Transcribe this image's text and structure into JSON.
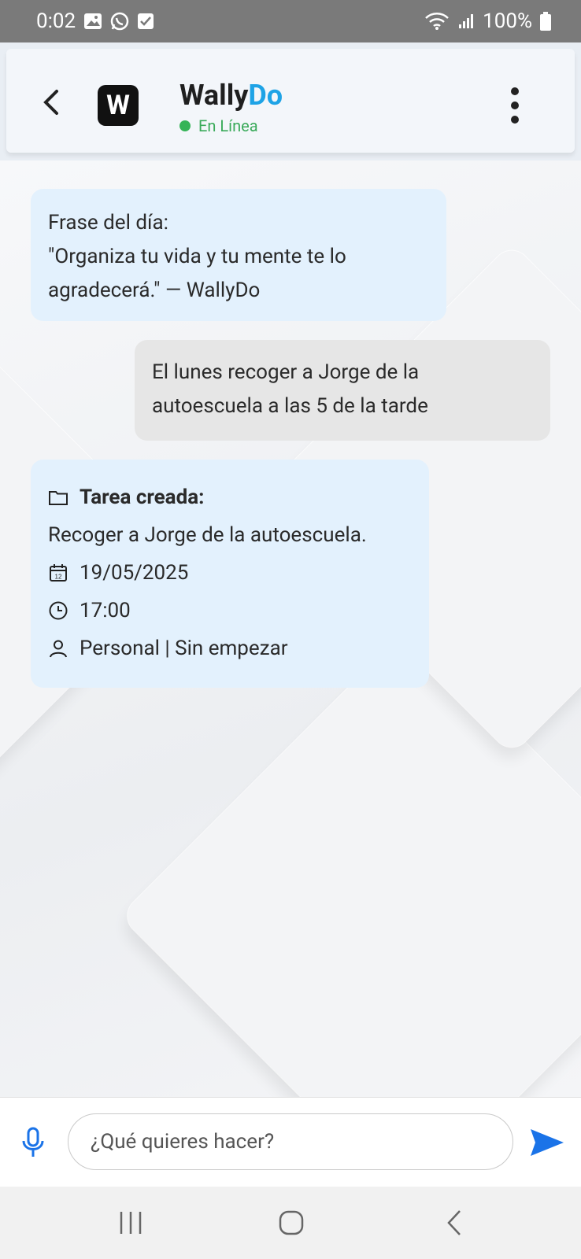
{
  "status_bar": {
    "time": "0:02",
    "battery": "100%"
  },
  "header": {
    "app_name_part1": "Wally",
    "app_name_part2": "Do",
    "logo_letter": "W",
    "status": "En Línea"
  },
  "messages": {
    "quote_title": "Frase del día:",
    "quote_line1": "\"Organiza tu vida y tu mente te lo",
    "quote_line2": "agradecerá.\" — WallyDo",
    "user_line1": "El lunes recoger a Jorge de la",
    "user_line2": "autoescuela a las 5 de la tarde",
    "task_header": "Tarea creada:",
    "task_desc": "Recoger a Jorge de la autoescuela.",
    "task_date": "19/05/2025",
    "task_time": "17:00",
    "task_meta": "Personal | Sin empezar"
  },
  "input": {
    "placeholder": "¿Qué quieres hacer?"
  },
  "colors": {
    "accent": "#1ea3e6",
    "online": "#35b457",
    "send": "#1a73e8",
    "bot_bubble": "#e3f1fd",
    "user_bubble": "#e6e6e6"
  },
  "icons": [
    "gallery-icon",
    "whatsapp-icon",
    "checkbox-icon",
    "wifi-icon",
    "signal-icon",
    "battery-icon",
    "back-arrow-icon",
    "more-vert-icon",
    "folder-icon",
    "calendar-icon",
    "clock-icon",
    "person-icon",
    "mic-icon",
    "send-icon",
    "recent-apps-icon",
    "home-icon",
    "nav-back-icon"
  ]
}
